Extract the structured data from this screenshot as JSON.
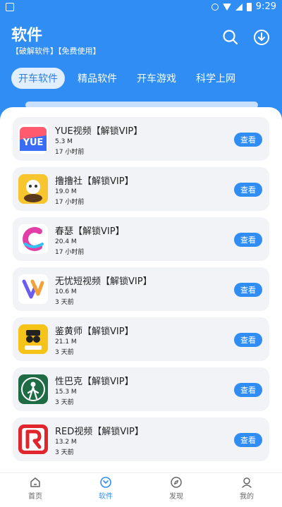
{
  "status": {
    "time": "9:29"
  },
  "header": {
    "title": "软件",
    "subtitle": "【破解软件】【免费使用】"
  },
  "tabs": [
    {
      "label": "开车软件",
      "active": true
    },
    {
      "label": "精品软件",
      "active": false
    },
    {
      "label": "开车游戏",
      "active": false
    },
    {
      "label": "科学上网",
      "active": false
    }
  ],
  "apps": [
    {
      "name": "YUE视频【解锁VIP】",
      "size": "5.3 M",
      "time": "17 小时前",
      "button": "查看"
    },
    {
      "name": "撸撸社【解锁VIP】",
      "size": "19.0 M",
      "time": "17 小时前",
      "button": "查看"
    },
    {
      "name": "春瑟【解锁VIP】",
      "size": "20.4 M",
      "time": "17 小时前",
      "button": "查看"
    },
    {
      "name": "无忧短视频【解锁VIP】",
      "size": "10.6 M",
      "time": "3 天前",
      "button": "查看"
    },
    {
      "name": "鉴黄师【解锁VIP】",
      "size": "21.1 M",
      "time": "3 天前",
      "button": "查看"
    },
    {
      "name": "性巴克【解锁VIP】",
      "size": "15.3 M",
      "time": "3 天前",
      "button": "查看"
    },
    {
      "name": "RED视频【解锁VIP】",
      "size": "13.2 M",
      "time": "3 天前",
      "button": "查看"
    }
  ],
  "nav": [
    {
      "label": "首页",
      "icon": "home-icon",
      "active": false
    },
    {
      "label": "软件",
      "icon": "software-icon",
      "active": true
    },
    {
      "label": "发现",
      "icon": "compass-icon",
      "active": false
    },
    {
      "label": "我的",
      "icon": "profile-icon",
      "active": false
    }
  ],
  "colors": {
    "primary": "#2f8df3"
  }
}
